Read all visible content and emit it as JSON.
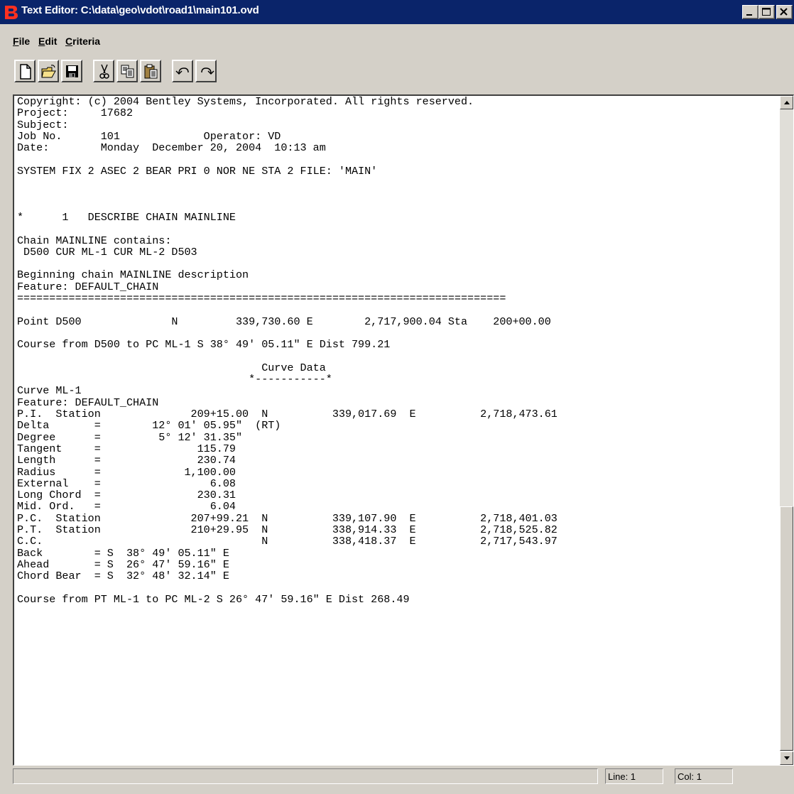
{
  "window": {
    "title": "Text Editor: C:\\data\\geo\\vdot\\road1\\main101.ovd",
    "app_icon": "bentley-b-icon"
  },
  "menu": {
    "items": [
      {
        "label": "File",
        "mnemonic": "F"
      },
      {
        "label": "Edit",
        "mnemonic": "E"
      },
      {
        "label": "Criteria",
        "mnemonic": "C"
      }
    ]
  },
  "toolbar": {
    "buttons": [
      "new-document-icon",
      "open-folder-icon",
      "save-disk-icon",
      "cut-scissors-icon",
      "copy-icon",
      "paste-clipboard-icon",
      "undo-icon",
      "redo-icon"
    ]
  },
  "document": {
    "lines": [
      "Copyright: (c) 2004 Bentley Systems, Incorporated. All rights reserved.",
      "Project:     17682",
      "Subject:",
      "Job No.      101             Operator: VD",
      "Date:        Monday  December 20, 2004  10:13 am",
      "",
      "SYSTEM FIX 2 ASEC 2 BEAR PRI 0 NOR NE STA 2 FILE: 'MAIN'",
      "",
      "",
      "",
      "*      1   DESCRIBE CHAIN MAINLINE",
      "",
      "Chain MAINLINE contains:",
      " D500 CUR ML-1 CUR ML-2 D503",
      "",
      "Beginning chain MAINLINE description",
      "Feature: DEFAULT_CHAIN",
      "============================================================================",
      "",
      "Point D500              N         339,730.60 E        2,717,900.04 Sta    200+00.00",
      "",
      "Course from D500 to PC ML-1 S 38° 49' 05.11\" E Dist 799.21",
      "",
      "                                      Curve Data",
      "                                    *-----------*",
      "Curve ML-1",
      "Feature: DEFAULT_CHAIN",
      "P.I.  Station              209+15.00  N          339,017.69  E          2,718,473.61",
      "Delta       =        12° 01' 05.95\"  (RT)",
      "Degree      =         5° 12' 31.35\"",
      "Tangent     =               115.79",
      "Length      =               230.74",
      "Radius      =             1,100.00",
      "External    =                 6.08",
      "Long Chord  =               230.31",
      "Mid. Ord.   =                 6.04",
      "P.C.  Station              207+99.21  N          339,107.90  E          2,718,401.03",
      "P.T.  Station              210+29.95  N          338,914.33  E          2,718,525.82",
      "C.C.                                  N          338,418.37  E          2,717,543.97",
      "Back        = S  38° 49' 05.11\" E",
      "Ahead       = S  26° 47' 59.16\" E",
      "Chord Bear  = S  32° 48' 32.14\" E",
      "",
      "Course from PT ML-1 to PC ML-2 S 26° 47' 59.16\" E Dist 268.49"
    ]
  },
  "status": {
    "message": "",
    "line": "Line: 1",
    "col": "Col: 1"
  }
}
